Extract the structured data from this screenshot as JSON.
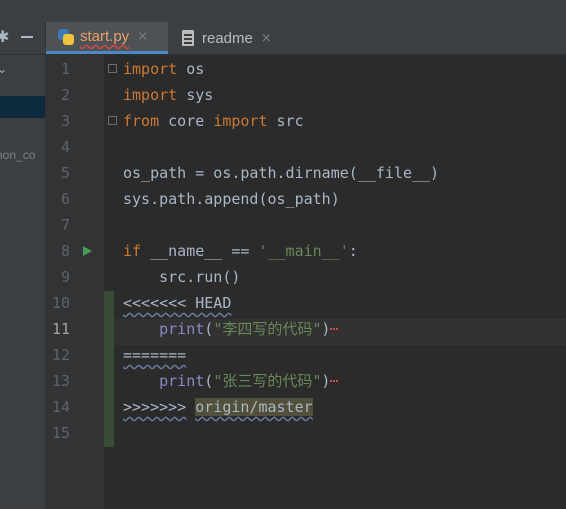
{
  "tabs": [
    {
      "label": "start.py",
      "close": "×",
      "icon": "python-file-icon",
      "active": true
    },
    {
      "label": "readme",
      "close": "×",
      "icon": "text-file-icon",
      "active": false
    }
  ],
  "left_panel": {
    "truncated_text": "non_co"
  },
  "gutter": {
    "line_numbers": [
      "1",
      "2",
      "3",
      "4",
      "5",
      "6",
      "7",
      "8",
      "9",
      "10",
      "11",
      "12",
      "13",
      "14",
      "15"
    ],
    "current_line": "11"
  },
  "code": {
    "line1": {
      "kw": "import",
      "rest": " os"
    },
    "line2": {
      "kw": "import",
      "rest": " sys"
    },
    "line3": {
      "kw1": "from",
      "mid": " core ",
      "kw2": "import",
      "rest": " src"
    },
    "line5": "os_path = os.path.dirname(__file__)",
    "line6": "sys.path.append(os_path)",
    "line8": {
      "kw": "if",
      "mid": " __name__ == ",
      "str": "'__main__'",
      "end": ":"
    },
    "line9": "    src.run()",
    "line10": "<<<<<<< HEAD",
    "line11": {
      "indent": "    ",
      "fn": "print",
      "open": "(",
      "str": "\"李四写的代码\"",
      "close": ")"
    },
    "line12": "=======",
    "line13": {
      "indent": "    ",
      "fn": "print",
      "open": "(",
      "str": "\"张三写的代码\"",
      "close": ")"
    },
    "line14": {
      "marker": ">>>>>>>",
      "space": " ",
      "branch": "origin/master"
    }
  },
  "colors": {
    "background": "#2b2b2b",
    "keyword": "#cc7832",
    "string": "#6a8759",
    "builtin": "#8888c6",
    "default_text": "#a9b7c6"
  }
}
